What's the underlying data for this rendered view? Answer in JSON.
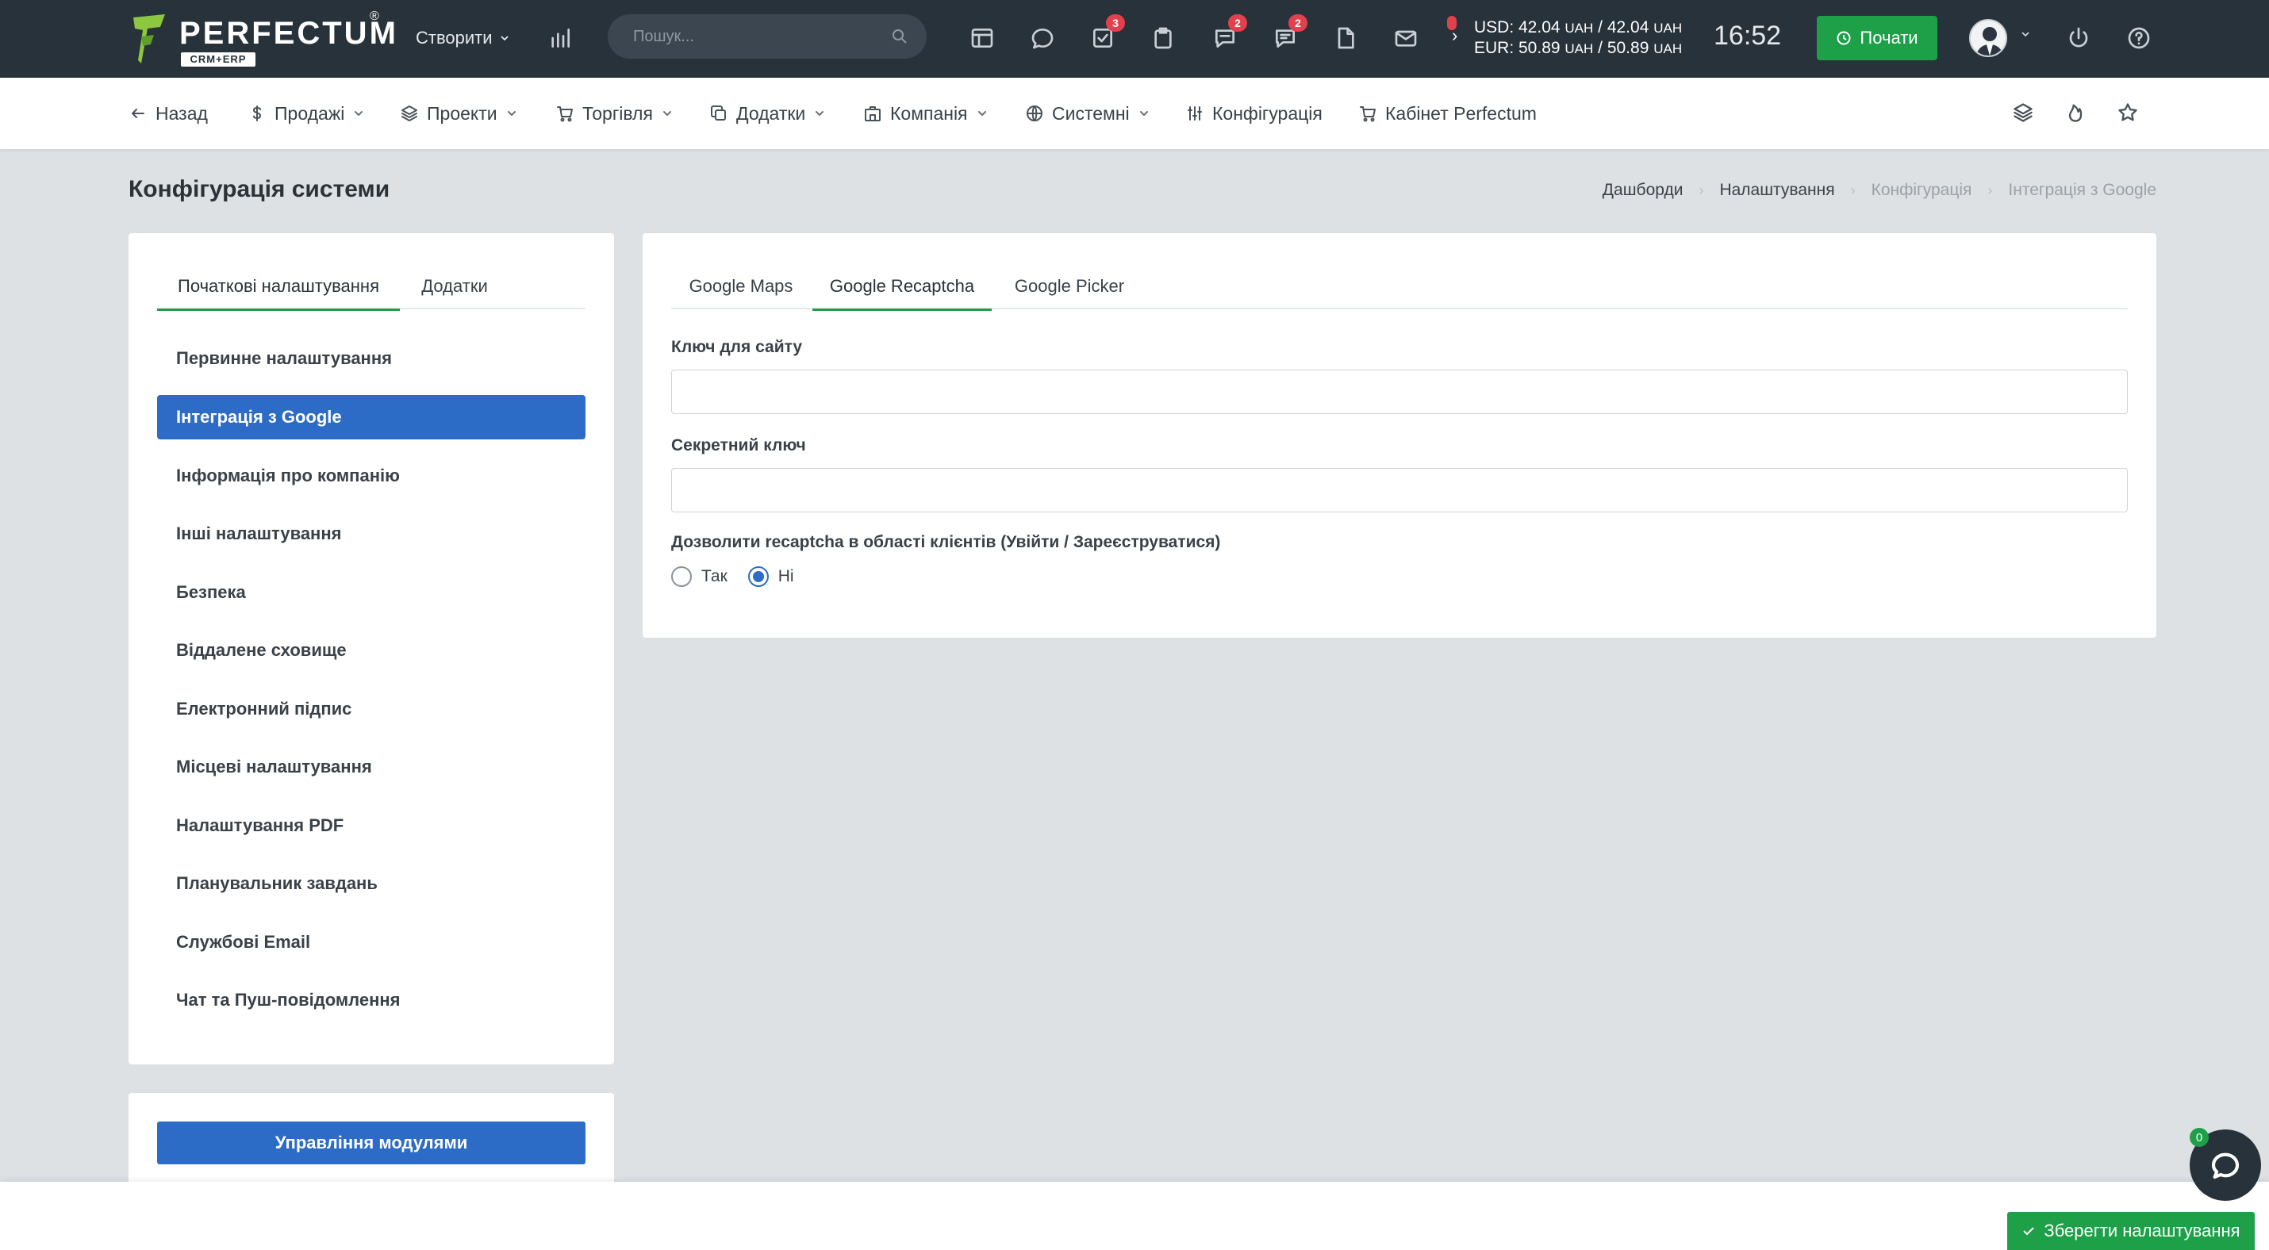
{
  "header": {
    "logo_text": "PERFECTUM",
    "logo_reg": "®",
    "logo_sub": "CRM+ERP",
    "create_label": "Створити",
    "search_placeholder": "Пошук...",
    "badges": {
      "tasks": "3",
      "messages": "2",
      "chat": "2"
    },
    "rates": {
      "usd_label": "USD: 42.04",
      "usd_unit_a": "UAH",
      "usd_sep": " / 42.04 ",
      "usd_unit_b": "UAH",
      "eur_label": "EUR: 50.89",
      "eur_unit_a": "UAH",
      "eur_sep": " / 50.89 ",
      "eur_unit_b": "UAH"
    },
    "time": "16:52",
    "start_label": "Почати"
  },
  "subnav": {
    "back": "Назад",
    "sales": "Продажі",
    "projects": "Проекти",
    "trade": "Торгівля",
    "addons": "Додатки",
    "company": "Компанія",
    "system": "Системні",
    "config": "Конфігурація",
    "cabinet": "Кабінет Perfectum"
  },
  "page": {
    "title": "Конфігурація системи",
    "breadcrumb": [
      "Дашборди",
      "Налаштування",
      "Конфігурація",
      "Інтеграція з Google"
    ]
  },
  "left": {
    "tabs": [
      "Початкові налаштування",
      "Додатки"
    ],
    "menu": [
      "Первинне налаштування",
      "Інтеграція з Google",
      "Інформація про компанію",
      "Інші налаштування",
      "Безпека",
      "Віддалене сховище",
      "Електронний підпис",
      "Місцеві налаштування",
      "Налаштування PDF",
      "Планувальник завдань",
      "Службові Email",
      "Чат та Пуш-повідомлення"
    ],
    "modules_button": "Управління модулями"
  },
  "right": {
    "tabs": [
      "Google Maps",
      "Google Recaptcha",
      "Google Picker"
    ],
    "site_key_label": "Ключ для сайту",
    "site_key_value": "",
    "secret_key_label": "Секретний ключ",
    "secret_key_value": "",
    "recaptcha_label": "Дозволити recaptcha в області клієнтів (Увійти / Зареєструватися)",
    "option_yes": "Так",
    "option_no": "Ні",
    "selected": "Ні"
  },
  "footer": {
    "save_label": "Зберегти налаштування",
    "chat_count": "0"
  },
  "colors": {
    "header_bg": "#27323b",
    "accent_green": "#1da047",
    "accent_blue": "#2d6cc6",
    "badge_red": "#e3404d",
    "page_bg": "#dde1e4"
  }
}
